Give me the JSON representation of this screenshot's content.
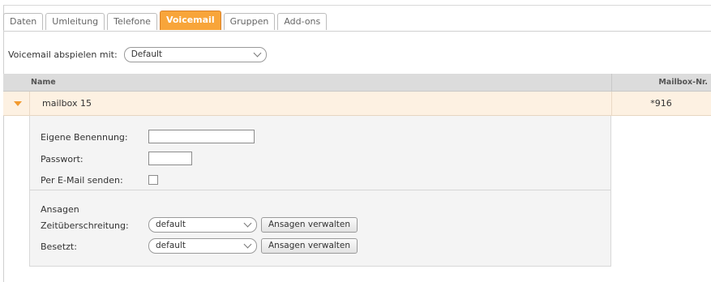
{
  "tabs": [
    {
      "label": "Daten",
      "active": false
    },
    {
      "label": "Umleitung",
      "active": false
    },
    {
      "label": "Telefone",
      "active": false
    },
    {
      "label": "Voicemail",
      "active": true
    },
    {
      "label": "Gruppen",
      "active": false
    },
    {
      "label": "Add-ons",
      "active": false
    }
  ],
  "playback": {
    "label": "Voicemail abspielen mit:",
    "selected": "Default"
  },
  "table": {
    "headers": {
      "name": "Name",
      "mailbox": "Mailbox-Nr."
    },
    "rows": [
      {
        "name": "mailbox 15",
        "mailbox": "*916",
        "expanded": true
      }
    ]
  },
  "details": {
    "custom_name_label": "Eigene Benennung:",
    "custom_name_value": "",
    "password_label": "Passwort:",
    "password_value": "",
    "email_label": "Per E-Mail senden:",
    "email_checked": false,
    "announcements": {
      "heading": "Ansagen",
      "timeout_label": "Zeitüberschreitung:",
      "timeout_selected": "default",
      "busy_label": "Besetzt:",
      "busy_selected": "default",
      "manage_button": "Ansagen verwalten"
    }
  },
  "colors": {
    "accent": "#f8a53a",
    "row_highlight": "#fdf1e2",
    "expand_arrow": "#f29a2e"
  }
}
